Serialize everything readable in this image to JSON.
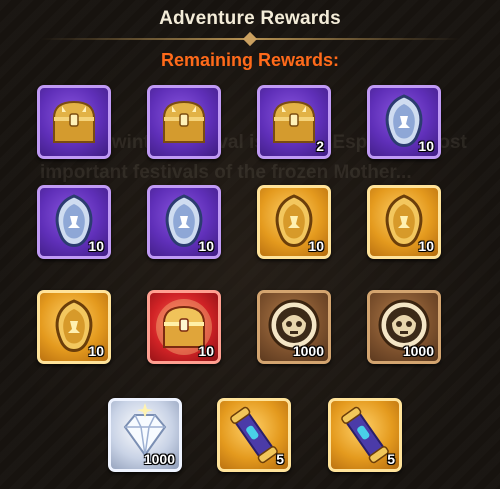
{
  "header": {
    "title": "Adventure Rewards",
    "subtitle": "Remaining Rewards:"
  },
  "background_text": "The Midwinter Festival is one of Esperia's most important festivals of the frozen Mother...",
  "colors": {
    "title": "#f3ecd8",
    "subtitle": "#ff6a1a",
    "rarity_purple": "#6a3cc8",
    "rarity_gold": "#e49a1e",
    "rarity_red": "#d12326",
    "rarity_bronze": "#7a4f2c"
  },
  "rewards": [
    {
      "icon": "treasure-chest-icon",
      "rarity": "purple",
      "count": ""
    },
    {
      "icon": "treasure-chest-icon",
      "rarity": "purple",
      "count": ""
    },
    {
      "icon": "treasure-chest-icon",
      "rarity": "purple",
      "count": "2"
    },
    {
      "icon": "silver-shard-icon",
      "rarity": "purple",
      "count": "10"
    },
    {
      "icon": "silver-shard-icon",
      "rarity": "purple",
      "count": "10"
    },
    {
      "icon": "silver-shard-icon",
      "rarity": "purple",
      "count": "10"
    },
    {
      "icon": "gold-shard-icon",
      "rarity": "gold",
      "count": "10"
    },
    {
      "icon": "gold-shard-icon",
      "rarity": "gold",
      "count": "10"
    },
    {
      "icon": "gold-shard-icon",
      "rarity": "gold",
      "count": "10"
    },
    {
      "icon": "treasure-chest-icon",
      "rarity": "red",
      "count": "10"
    },
    {
      "icon": "skull-coin-icon",
      "rarity": "bronze",
      "count": "1000"
    },
    {
      "icon": "skull-coin-icon",
      "rarity": "bronze",
      "count": "1000"
    },
    {
      "icon": "diamond-icon",
      "rarity": "white",
      "count": "1000"
    },
    {
      "icon": "scroll-icon",
      "rarity": "gold",
      "count": "5"
    },
    {
      "icon": "scroll-icon",
      "rarity": "gold",
      "count": "5"
    }
  ]
}
